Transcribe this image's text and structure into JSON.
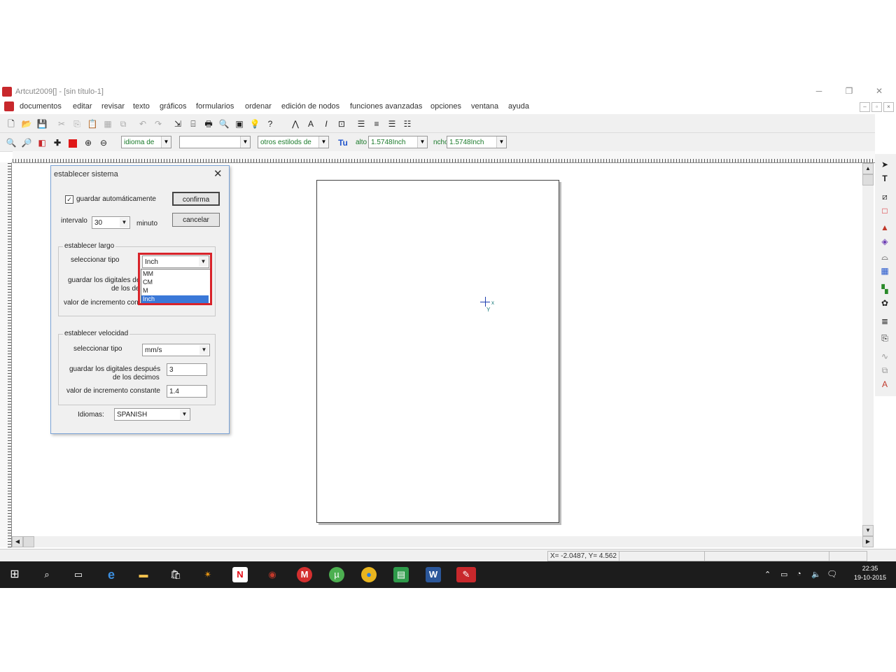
{
  "window": {
    "title": "Artcut2009[] - [sin título-1]",
    "minimize": "─",
    "restore": "❐",
    "close": "✕"
  },
  "menu": [
    "documentos",
    "editar",
    "revisar",
    "texto",
    "gráficos",
    "formularios",
    "ordenar",
    "edición de nodos",
    "funciones avanzadas",
    "opciones",
    "ventana",
    "ayuda"
  ],
  "toolbar2": {
    "language_combo": "idioma de",
    "font_combo": "",
    "style_combo": "otros estilods de",
    "height_label": "alto",
    "height_value": "1.5748Inch",
    "width_label": "ncho",
    "width_value": "1.5748Inch"
  },
  "canvas": {
    "crosshair_x": "x",
    "crosshair_y": "Y"
  },
  "status": {
    "coords": "X= -2.0487, Y= 4.562"
  },
  "dialog": {
    "title": "establecer sistema",
    "close": "✕",
    "autosave_label": "guardar automáticamente",
    "autosave_checked": true,
    "confirm_button": "confirma",
    "cancel_button": "cancelar",
    "interval_label": "intervalo",
    "interval_value": "30",
    "interval_unit": "minuto",
    "length_group": {
      "legend": "establecer largo",
      "select_type_label": "seleccionar tipo",
      "select_type_value": "Inch",
      "options": [
        "MM",
        "CM",
        "M",
        "Inch"
      ],
      "selected_option": "Inch",
      "decimals_label_1": "guardar los digitales de",
      "decimals_label_2": "de los de",
      "increment_label": "valor de incremento con"
    },
    "speed_group": {
      "legend": "establecer velocidad",
      "select_type_label": "seleccionar tipo",
      "select_type_value": "mm/s",
      "decimals_label_1": "guardar los digitales después",
      "decimals_label_2": "de los decimos",
      "decimals_value": "3",
      "increment_label": "valor de incremento constante",
      "increment_value": "1.4"
    },
    "language_label": "Idiomas:",
    "language_value": "SPANISH"
  },
  "taskbar": {
    "time": "22:35",
    "date": "19-10-2015"
  },
  "colors": {
    "highlight": "#3a78d8",
    "annotation_red": "#d8232a",
    "taskbar": "#1c1c1c"
  }
}
